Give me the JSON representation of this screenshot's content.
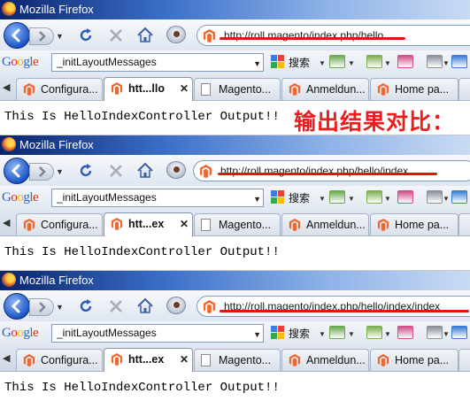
{
  "window_title": "Mozilla Firefox",
  "search_engine": "Google",
  "search_selected": "_initLayoutMessages",
  "search_button": "搜索",
  "annotation": "输出结果对比：",
  "output": "This Is HelloIndexController Output!!",
  "colors": {
    "annotation": "#ee1c1c",
    "underline": "#e3140f",
    "titlebar": "#0a246a"
  },
  "shots": [
    {
      "url": "http://roll.magento/index.php/hello",
      "tabs": [
        "Configura...",
        "htt...llo",
        "Magento...",
        "Anmeldun...",
        "Home pa..."
      ],
      "active_tab": 1
    },
    {
      "url": "http://roll.magento/index.php/hello/index",
      "tabs": [
        "Configura...",
        "htt...ex",
        "Magento...",
        "Anmeldun...",
        "Home pa..."
      ],
      "active_tab": 1
    },
    {
      "url": "http://roll.magento/index.php/hello/index/index",
      "tabs": [
        "Configura...",
        "htt...ex",
        "Magento...",
        "Anmeldun...",
        "Home pa..."
      ],
      "active_tab": 1
    }
  ]
}
